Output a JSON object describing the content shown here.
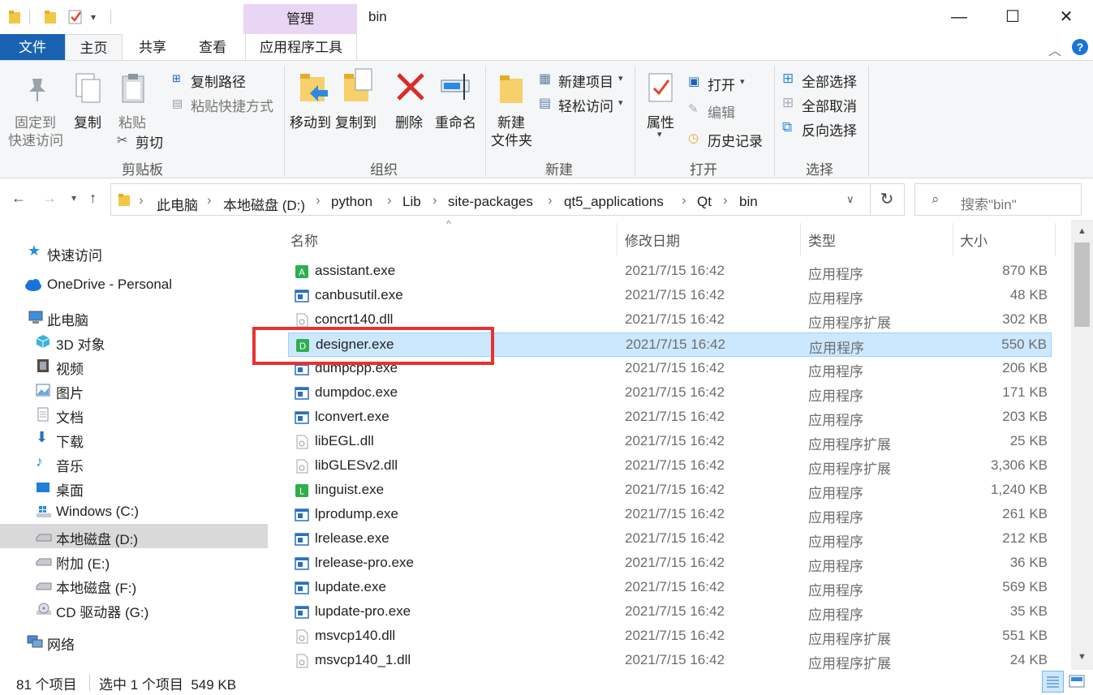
{
  "window": {
    "title": "bin",
    "context_tab": "管理",
    "controls": {
      "minimize": "—",
      "maximize": "☐",
      "close": "✕"
    }
  },
  "ribbon_tabs": {
    "file": "文件",
    "home": "主页",
    "share": "共享",
    "view": "查看",
    "apptools": "应用程序工具"
  },
  "ribbon": {
    "clipboard": {
      "pin_line1": "固定到",
      "pin_line2": "快速访问",
      "copy": "复制",
      "paste": "粘贴",
      "copy_path": "复制路径",
      "paste_shortcut": "粘贴快捷方式",
      "cut": "剪切",
      "label": "剪贴板"
    },
    "organize": {
      "move_to": "移动到",
      "copy_to": "复制到",
      "delete": "删除",
      "rename": "重命名",
      "label": "组织"
    },
    "new": {
      "new_item": "新建项目",
      "easy_access": "轻松访问",
      "new_folder_line1": "新建",
      "new_folder_line2": "文件夹",
      "label": "新建"
    },
    "open": {
      "properties": "属性",
      "open": "打开",
      "edit": "编辑",
      "history": "历史记录",
      "label": "打开"
    },
    "select": {
      "select_all": "全部选择",
      "select_none": "全部取消",
      "invert": "反向选择",
      "label": "选择"
    }
  },
  "address": {
    "crumbs": [
      "此电脑",
      "本地磁盘 (D:)",
      "python",
      "Lib",
      "site-packages",
      "qt5_applications",
      "Qt",
      "bin"
    ],
    "search_placeholder": "搜索\"bin\""
  },
  "nav": {
    "quick_access": "快速访问",
    "onedrive": "OneDrive - Personal",
    "this_pc": "此电脑",
    "objects3d": "3D 对象",
    "videos": "视频",
    "pictures": "图片",
    "documents": "文档",
    "downloads": "下载",
    "music": "音乐",
    "desktop": "桌面",
    "drive_c": "Windows (C:)",
    "drive_d": "本地磁盘 (D:)",
    "drive_e": "附加 (E:)",
    "drive_f": "本地磁盘 (F:)",
    "drive_g": "CD 驱动器 (G:)",
    "network": "网络"
  },
  "columns": {
    "name": "名称",
    "date": "修改日期",
    "type": "类型",
    "size": "大小"
  },
  "files": [
    {
      "name": "assistant.exe",
      "date": "2021/7/15 16:42",
      "type": "应用程序",
      "size": "870 KB",
      "icon": "green-app-icon",
      "badge": "A"
    },
    {
      "name": "canbusutil.exe",
      "date": "2021/7/15 16:42",
      "type": "应用程序",
      "size": "48 KB",
      "icon": "exe-icon"
    },
    {
      "name": "concrt140.dll",
      "date": "2021/7/15 16:42",
      "type": "应用程序扩展",
      "size": "302 KB",
      "icon": "dll-icon"
    },
    {
      "name": "designer.exe",
      "date": "2021/7/15 16:42",
      "type": "应用程序",
      "size": "550 KB",
      "icon": "green-app-icon",
      "badge": "D",
      "selected": true
    },
    {
      "name": "dumpcpp.exe",
      "date": "2021/7/15 16:42",
      "type": "应用程序",
      "size": "206 KB",
      "icon": "exe-icon"
    },
    {
      "name": "dumpdoc.exe",
      "date": "2021/7/15 16:42",
      "type": "应用程序",
      "size": "171 KB",
      "icon": "exe-icon"
    },
    {
      "name": "lconvert.exe",
      "date": "2021/7/15 16:42",
      "type": "应用程序",
      "size": "203 KB",
      "icon": "exe-icon"
    },
    {
      "name": "libEGL.dll",
      "date": "2021/7/15 16:42",
      "type": "应用程序扩展",
      "size": "25 KB",
      "icon": "dll-icon"
    },
    {
      "name": "libGLESv2.dll",
      "date": "2021/7/15 16:42",
      "type": "应用程序扩展",
      "size": "3,306 KB",
      "icon": "dll-icon"
    },
    {
      "name": "linguist.exe",
      "date": "2021/7/15 16:42",
      "type": "应用程序",
      "size": "1,240 KB",
      "icon": "green-app-icon",
      "badge": "L"
    },
    {
      "name": "lprodump.exe",
      "date": "2021/7/15 16:42",
      "type": "应用程序",
      "size": "261 KB",
      "icon": "exe-icon"
    },
    {
      "name": "lrelease.exe",
      "date": "2021/7/15 16:42",
      "type": "应用程序",
      "size": "212 KB",
      "icon": "exe-icon"
    },
    {
      "name": "lrelease-pro.exe",
      "date": "2021/7/15 16:42",
      "type": "应用程序",
      "size": "36 KB",
      "icon": "exe-icon"
    },
    {
      "name": "lupdate.exe",
      "date": "2021/7/15 16:42",
      "type": "应用程序",
      "size": "569 KB",
      "icon": "exe-icon"
    },
    {
      "name": "lupdate-pro.exe",
      "date": "2021/7/15 16:42",
      "type": "应用程序",
      "size": "35 KB",
      "icon": "exe-icon"
    },
    {
      "name": "msvcp140.dll",
      "date": "2021/7/15 16:42",
      "type": "应用程序扩展",
      "size": "551 KB",
      "icon": "dll-icon"
    },
    {
      "name": "msvcp140_1.dll",
      "date": "2021/7/15 16:42",
      "type": "应用程序扩展",
      "size": "24 KB",
      "icon": "dll-icon"
    }
  ],
  "status": {
    "count": "81 个项目",
    "selection": "选中 1 个项目  549 KB"
  },
  "colors": {
    "file_tab": "#1a63b2",
    "selection": "#cce8ff",
    "annotation": "#e8322f",
    "manage_tab": "#e9d6f4"
  }
}
